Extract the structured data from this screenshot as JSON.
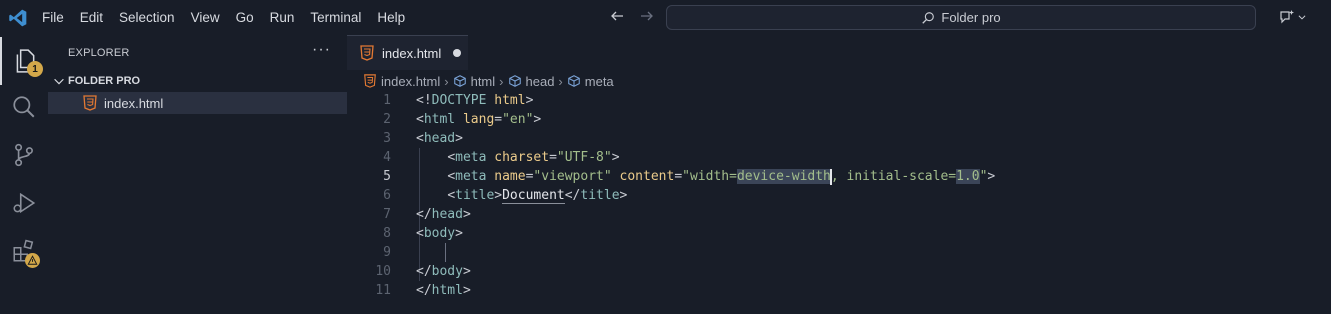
{
  "menu": [
    "File",
    "Edit",
    "Selection",
    "View",
    "Go",
    "Run",
    "Terminal",
    "Help"
  ],
  "search": {
    "text": "Folder pro"
  },
  "activity": {
    "explorer_badge": "1"
  },
  "sidebar": {
    "title": "EXPLORER",
    "more": "···",
    "folder": "FOLDER PRO",
    "files": [
      "index.html"
    ]
  },
  "tab": {
    "label": "index.html"
  },
  "breadcrumb": {
    "file": "index.html",
    "html": "html",
    "head": "head",
    "meta": "meta"
  },
  "editor": {
    "line_numbers": [
      "1",
      "2",
      "3",
      "4",
      "5",
      "6",
      "7",
      "8",
      "9",
      "10",
      "11"
    ],
    "current_line": 5
  },
  "colors": {
    "background": "#181d28",
    "html_icon": "#e37933",
    "badge": "#d3a84a",
    "warning": "#d3a84a"
  }
}
